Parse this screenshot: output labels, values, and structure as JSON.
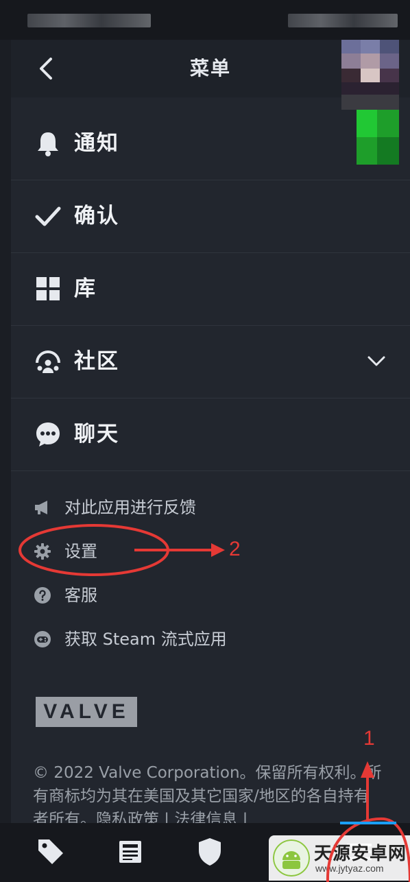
{
  "header": {
    "title": "菜单",
    "back_icon": "chevron-left-icon"
  },
  "menu": [
    {
      "label": "通知",
      "icon": "bell-icon"
    },
    {
      "label": "确认",
      "icon": "check-icon"
    },
    {
      "label": "库",
      "icon": "grid-icon"
    },
    {
      "label": "社区",
      "icon": "community-icon",
      "expandable": true
    },
    {
      "label": "聊天",
      "icon": "chat-icon"
    }
  ],
  "secondary": [
    {
      "label": "对此应用进行反馈",
      "icon": "megaphone-icon"
    },
    {
      "label": "设置",
      "icon": "gear-icon"
    },
    {
      "label": "客服",
      "icon": "help-icon"
    },
    {
      "label": "获取 Steam 流式应用",
      "icon": "gamepad-icon"
    }
  ],
  "brand": {
    "logo_text": "VALVE"
  },
  "footer": {
    "copyright": "© 2022 Valve Corporation。保留所有权利。所有商标均为其在美国及其它国家/地区的各自持有者所有。隐私政策 | 法律信息 |"
  },
  "bottom_tabs": [
    {
      "icon": "tag-icon"
    },
    {
      "icon": "news-icon"
    },
    {
      "icon": "shield-icon"
    },
    {
      "icon": "menu-icon"
    }
  ],
  "annotations": {
    "step1": "1",
    "step2": "2",
    "color": "#e53935"
  },
  "watermark": {
    "name": "天源安卓网",
    "url": "www.jytyaz.com"
  }
}
